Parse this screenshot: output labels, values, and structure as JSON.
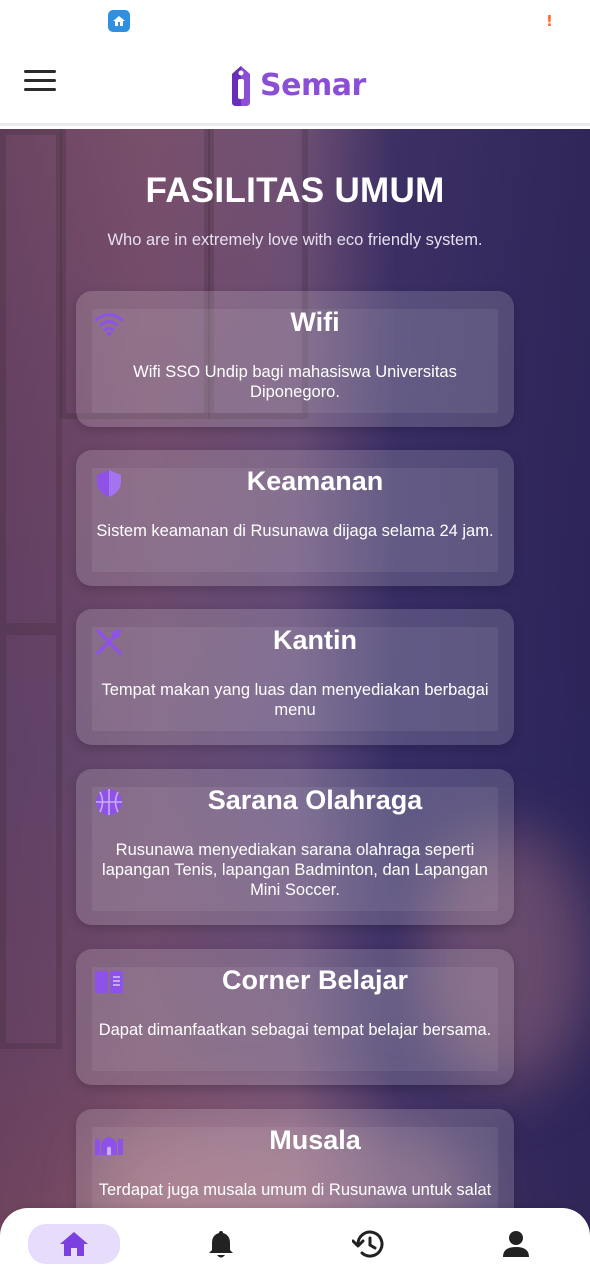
{
  "app": {
    "name": "Semar",
    "brand_color": "#8b4fd6",
    "icons": {
      "status_app": "cloud-home-icon",
      "status_alert": "alert-icon",
      "menu": "hamburger-menu-icon",
      "logo": "semar-logo-icon"
    },
    "status_alert_text": "!"
  },
  "section": {
    "title": "FASILITAS UMUM",
    "subtitle": "Who are in extremely love with eco friendly system."
  },
  "facilities": [
    {
      "icon": "wifi-icon",
      "title": "Wifi",
      "description": "Wifi SSO Undip bagi mahasiswa Universitas Diponegoro."
    },
    {
      "icon": "shield-icon",
      "title": "Keamanan",
      "description": "Sistem keamanan di Rusunawa dijaga selama 24 jam."
    },
    {
      "icon": "utensils-icon",
      "title": "Kantin",
      "description": "Tempat makan yang luas dan menyediakan berbagai menu"
    },
    {
      "icon": "basketball-icon",
      "title": "Sarana Olahraga",
      "description": "Rusunawa menyediakan sarana olahraga seperti lapangan Tenis, lapangan Badminton, dan Lapangan Mini Soccer."
    },
    {
      "icon": "book-open-icon",
      "title": "Corner Belajar",
      "description": "Dapat dimanfaatkan sebagai tempat belajar bersama."
    },
    {
      "icon": "mosque-icon",
      "title": "Musala",
      "description": "Terdapat juga musala umum di Rusunawa untuk salat"
    }
  ],
  "bottom_nav": {
    "items": [
      {
        "icon": "home-icon",
        "active": true
      },
      {
        "icon": "bell-icon",
        "active": false
      },
      {
        "icon": "history-icon",
        "active": false
      },
      {
        "icon": "user-icon",
        "active": false
      }
    ],
    "active_color": "#7c3fe0",
    "active_bg": "#e7dcfb"
  }
}
